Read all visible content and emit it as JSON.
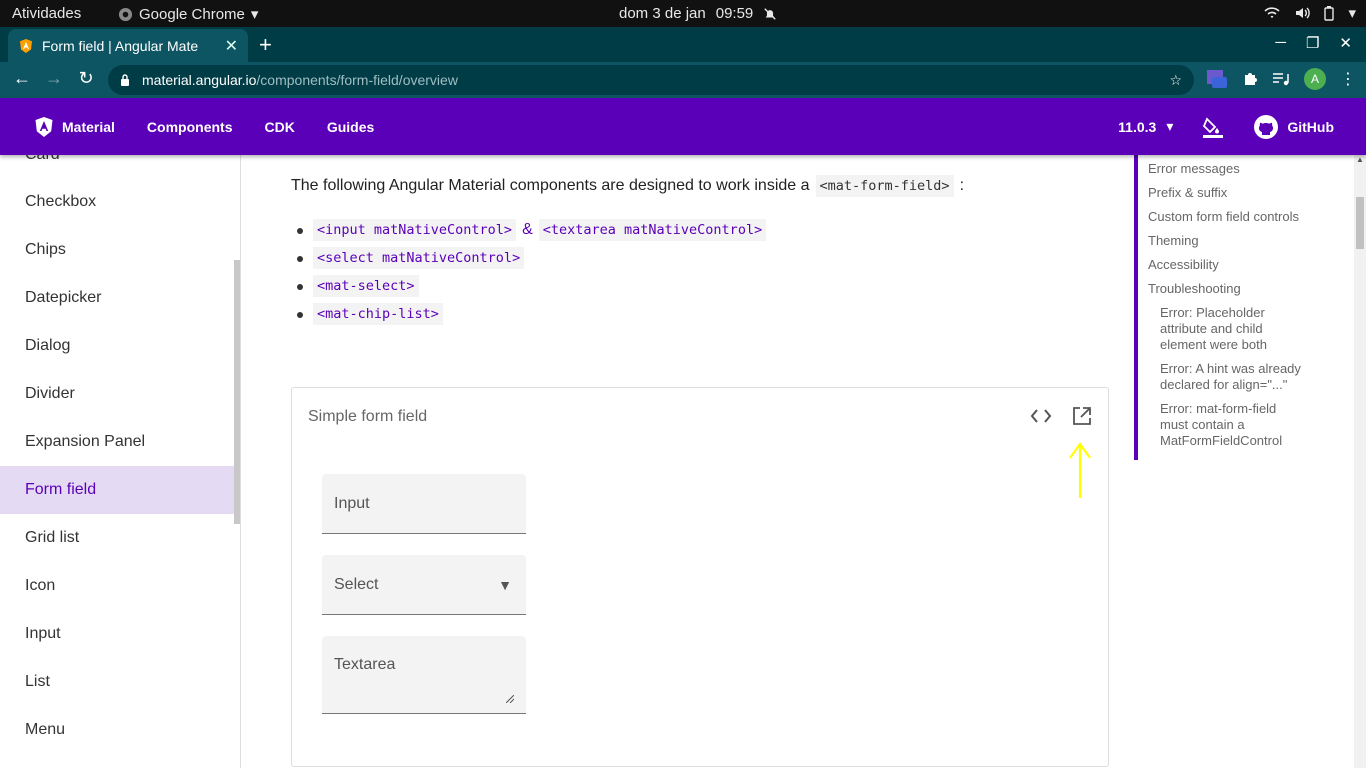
{
  "system": {
    "activities": "Atividades",
    "app_name": "Google Chrome",
    "date": "dom 3 de jan",
    "time": "09:59"
  },
  "browser": {
    "tab_title": "Form field | Angular Mate",
    "url_host": "material.angular.io",
    "url_path": "/components/form-field/overview",
    "avatar_letter": "A"
  },
  "header": {
    "brand": "Material",
    "nav": [
      "Components",
      "CDK",
      "Guides"
    ],
    "version": "11.0.3",
    "github": "GitHub"
  },
  "sidenav": {
    "partial_top": "Card",
    "items": [
      "Checkbox",
      "Chips",
      "Datepicker",
      "Dialog",
      "Divider",
      "Expansion Panel",
      "Form field",
      "Grid list",
      "Icon",
      "Input",
      "List",
      "Menu"
    ],
    "active": "Form field"
  },
  "content": {
    "intro_text": "The following Angular Material components are designed to work inside a",
    "intro_code": "<mat-form-field>",
    "intro_end": ":",
    "bullets": [
      {
        "code": "<input matNativeControl>",
        "joiner": "&",
        "code2": "<textarea matNativeControl>"
      },
      {
        "code": "<select matNativeControl>"
      },
      {
        "code": "<mat-select>"
      },
      {
        "code": "<mat-chip-list>"
      }
    ],
    "example": {
      "title": "Simple form field",
      "fields": [
        "Input",
        "Select",
        "Textarea"
      ]
    }
  },
  "toc": {
    "items": [
      "Error messages",
      "Prefix & suffix",
      "Custom form field controls",
      "Theming",
      "Accessibility",
      "Troubleshooting"
    ],
    "subitems": [
      "Error: Placeholder attribute and child element were both specified",
      "Error: A hint was already declared for align=\"...\"",
      "Error: mat-form-field must contain a MatFormFieldControl"
    ]
  },
  "colors": {
    "primary": "#5a00b8",
    "annotation_arrow": "#ffff00"
  }
}
